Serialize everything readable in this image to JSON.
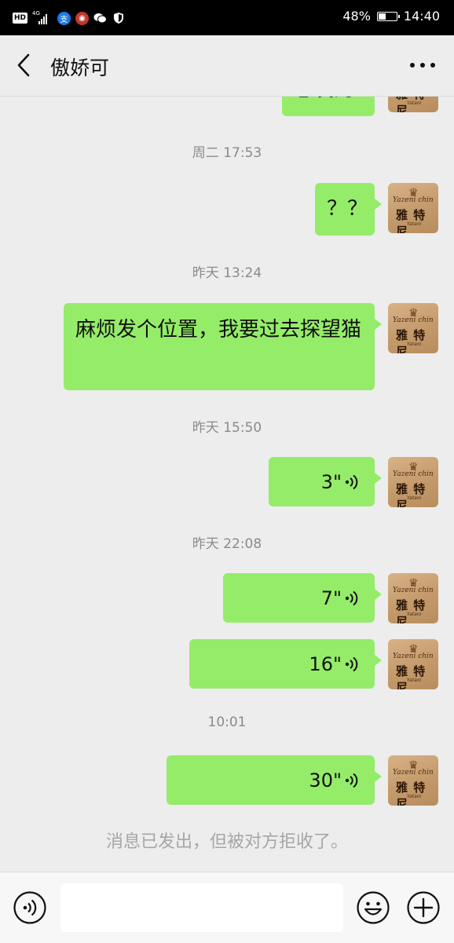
{
  "status_bar": {
    "hd_label": "HD",
    "network_label": "4G",
    "battery_text": "48%",
    "battery_level": 0.48,
    "time": "14:40",
    "app_icons": [
      "alipay-icon",
      "app-icon",
      "wechat-icon",
      "shield-icon"
    ]
  },
  "header": {
    "title": "傲娇可",
    "back_icon": "chevron-left-icon",
    "more_icon": "more-icon"
  },
  "avatar": {
    "text": "雅 特 尼",
    "script": "Yazeni chin",
    "small": "Yatani"
  },
  "messages": [
    {
      "type": "text",
      "text": "您发的"
    },
    {
      "type": "time",
      "text": "周二 17:53"
    },
    {
      "type": "text",
      "text": "？？"
    },
    {
      "type": "time",
      "text": "昨天 13:24"
    },
    {
      "type": "text",
      "text": "麻烦发个位置，我要过去探望猫"
    },
    {
      "type": "time",
      "text": "昨天 15:50"
    },
    {
      "type": "voice",
      "duration": "3\""
    },
    {
      "type": "time",
      "text": "昨天 22:08"
    },
    {
      "type": "voice",
      "duration": "7\""
    },
    {
      "type": "voice",
      "duration": "16\""
    },
    {
      "type": "time",
      "text": "10:01"
    },
    {
      "type": "voice",
      "duration": "30\""
    }
  ],
  "system_note": "消息已发出，但被对方拒收了。",
  "input_bar": {
    "voice_icon": "voice-mode-icon",
    "emoji_icon": "emoji-icon",
    "plus_icon": "plus-icon",
    "input_value": ""
  },
  "colors": {
    "bubble": "#95ec69",
    "background": "#ededed",
    "timestamp": "#8a8a8a"
  }
}
